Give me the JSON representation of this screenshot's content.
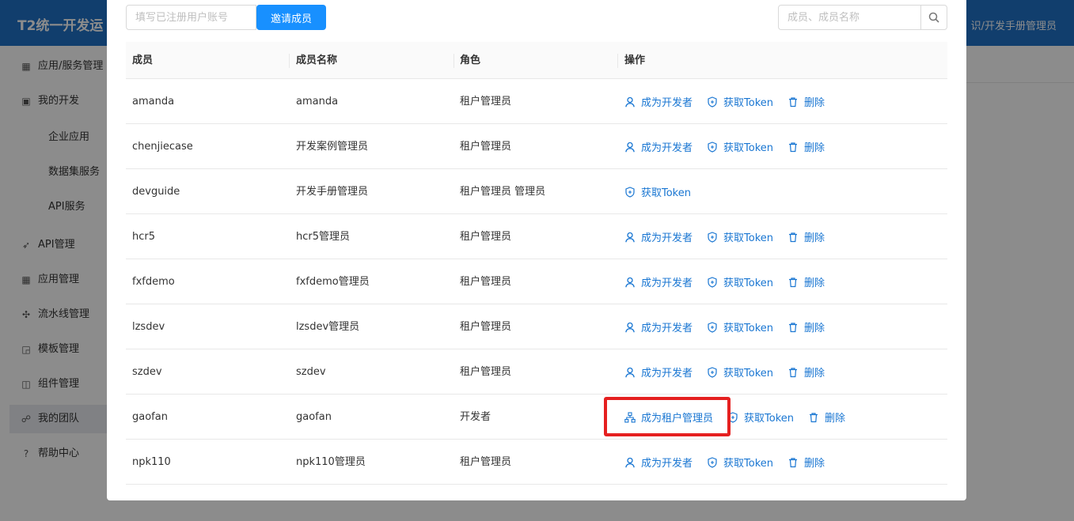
{
  "app": {
    "title": "T2统一开发运",
    "user": "识/开发手册管理员"
  },
  "sidebar": {
    "items": [
      {
        "label": "应用/服务管理",
        "icon": "grid-icon"
      },
      {
        "label": "我的开发",
        "icon": "window-icon"
      },
      {
        "label": "企业应用"
      },
      {
        "label": "数据集服务"
      },
      {
        "label": "API服务"
      },
      {
        "label": "API管理",
        "icon": "rocket-icon"
      },
      {
        "label": "应用管理",
        "icon": "apps-icon"
      },
      {
        "label": "流水线管理",
        "icon": "pipeline-icon"
      },
      {
        "label": "模板管理",
        "icon": "template-icon"
      },
      {
        "label": "组件管理",
        "icon": "component-icon"
      },
      {
        "label": "我的团队",
        "icon": "team-icon"
      },
      {
        "label": "帮助中心",
        "icon": "help-icon"
      }
    ]
  },
  "modal": {
    "invite_placeholder": "填写已注册用户账号",
    "invite_button": "邀请成员",
    "search_placeholder": "成员、成员名称",
    "columns": [
      "成员",
      "成员名称",
      "角色",
      "操作"
    ],
    "actions": {
      "become_developer": "成为开发者",
      "become_admin": "成为租户管理员",
      "get_token": "获取Token",
      "delete": "删除"
    },
    "rows": [
      {
        "member": "amanda",
        "name": "amanda",
        "role": "租户管理员"
      },
      {
        "member": "chenjiecase",
        "name": "开发案例管理员",
        "role": "租户管理员"
      },
      {
        "member": "devguide",
        "name": "开发手册管理员",
        "role": "租户管理员 管理员"
      },
      {
        "member": "hcr5",
        "name": "hcr5管理员",
        "role": "租户管理员"
      },
      {
        "member": "fxfdemo",
        "name": "fxfdemo管理员",
        "role": "租户管理员"
      },
      {
        "member": "lzsdev",
        "name": "lzsdev管理员",
        "role": "租户管理员"
      },
      {
        "member": "szdev",
        "name": "szdev",
        "role": "租户管理员"
      },
      {
        "member": "gaofan",
        "name": "gaofan",
        "role": "开发者"
      },
      {
        "member": "npk110",
        "name": "npk110管理员",
        "role": "租户管理员"
      }
    ]
  },
  "colors": {
    "primary": "#1890ff",
    "link": "#1976d2",
    "header": "#1f71c7",
    "highlight": "#e52020"
  }
}
